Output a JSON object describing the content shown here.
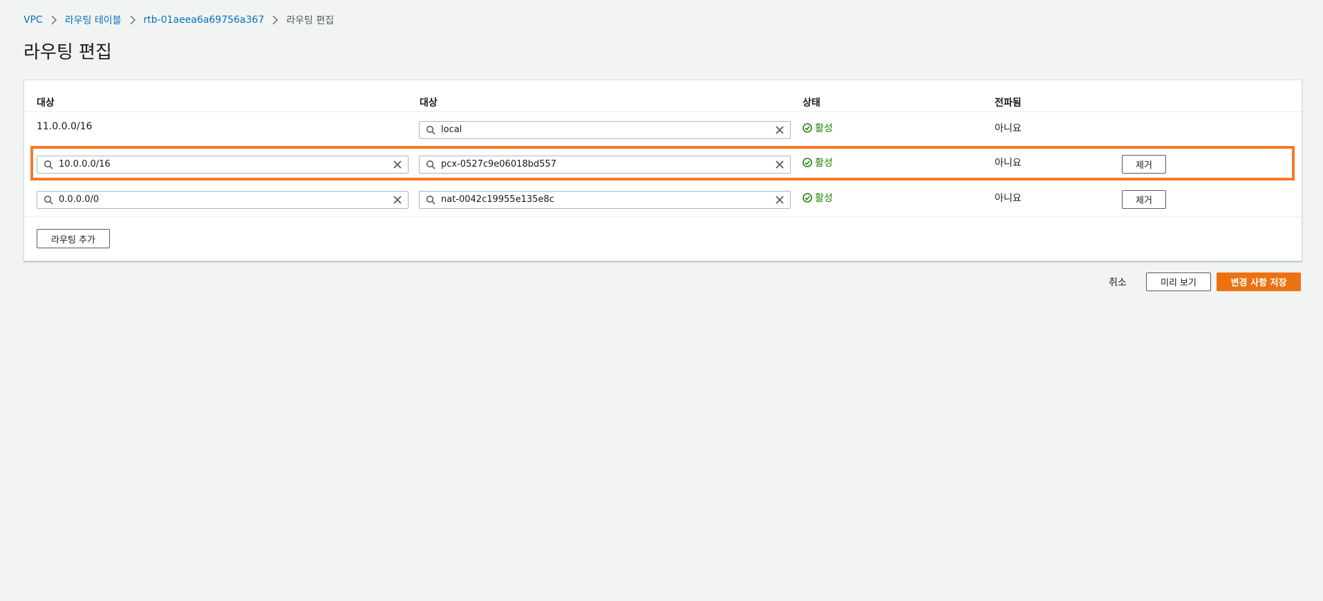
{
  "breadcrumb": {
    "items": [
      "VPC",
      "라우팅 테이블",
      "rtb-01aeea6a69756a367"
    ],
    "current": "라우팅 편집"
  },
  "page": {
    "title": "라우팅 편집"
  },
  "table": {
    "headers": {
      "destination": "대상",
      "target": "대상",
      "status": "상태",
      "propagated": "전파됨"
    },
    "rows": [
      {
        "destination": "11.0.0.0/16",
        "target": "local",
        "status": "활성",
        "propagated": "아니요"
      },
      {
        "destination": "10.0.0.0/16",
        "target": "pcx-0527c9e06018bd557",
        "status": "활성",
        "propagated": "아니요",
        "remove_label": "제거"
      },
      {
        "destination": "0.0.0.0/0",
        "target": "nat-0042c19955e135e8c",
        "status": "활성",
        "propagated": "아니요",
        "remove_label": "제거"
      }
    ],
    "add_route_label": "라우팅 추가"
  },
  "footer": {
    "cancel_label": "취소",
    "preview_label": "미리 보기",
    "save_label": "변경 사항 저장"
  },
  "colors": {
    "accent": "#ec7211",
    "highlight": "#f5792a",
    "link": "#0073bb",
    "success": "#1d8102"
  },
  "icons": {
    "search": "search-icon",
    "clear": "close-icon",
    "status": "check-circle-icon",
    "separator": "chevron-right-icon"
  }
}
